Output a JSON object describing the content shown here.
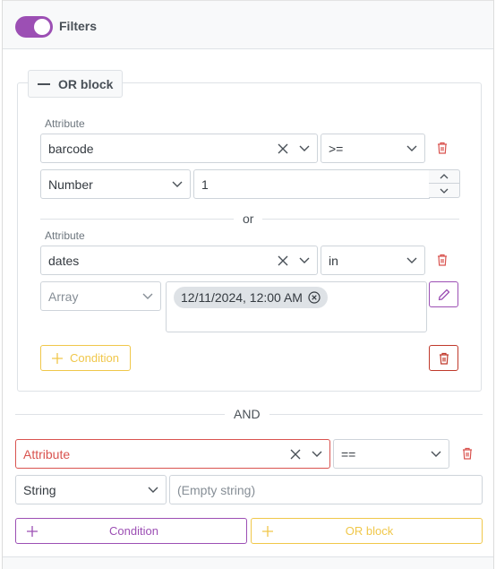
{
  "header": {
    "toggle_on": true,
    "title": "Filters"
  },
  "colors": {
    "accent": "#9c4fb4",
    "warning": "#f0c74a",
    "danger": "#d9534f",
    "border": "#ced4da"
  },
  "or_block": {
    "legend": "OR block",
    "separator": "or",
    "conditions": [
      {
        "attribute_label": "Attribute",
        "attribute": "barcode",
        "operator": ">=",
        "value_type": "Number",
        "value": "1"
      },
      {
        "attribute_label": "Attribute",
        "attribute": "dates",
        "operator": "in",
        "value_type": "Array",
        "value_chips": [
          "12/11/2024, 12:00 AM"
        ]
      }
    ],
    "add_condition_label": "Condition"
  },
  "and_separator": "AND",
  "root_condition": {
    "attribute_placeholder": "Attribute",
    "operator": "==",
    "value_type": "String",
    "value_placeholder": "(Empty string)"
  },
  "footer_buttons": {
    "add_condition": "Condition",
    "add_or_block": "OR block"
  }
}
